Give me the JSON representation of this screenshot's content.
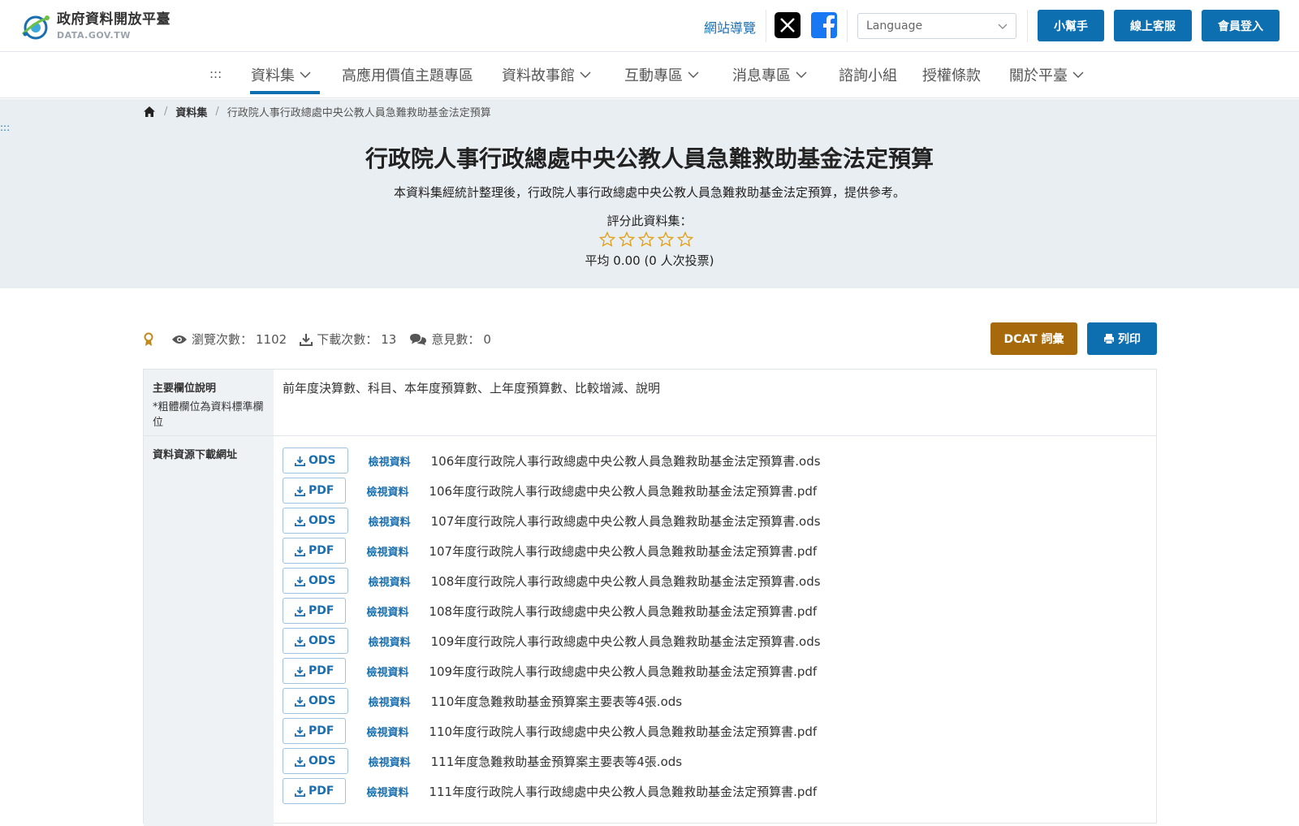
{
  "header": {
    "logo_cn": "政府資料開放平臺",
    "logo_en": "DATA.GOV.TW",
    "sitemap": "網站導覽",
    "language_placeholder": "Language",
    "buttons": [
      "小幫手",
      "線上客服",
      "會員登入"
    ]
  },
  "nav": {
    "dots": ":::",
    "items": [
      "資料集",
      "高應用價值主題專區",
      "資料故事館",
      "互動專區",
      "消息專區",
      "諮詢小組",
      "授權條款",
      "關於平臺"
    ]
  },
  "breadcrumb": {
    "items": [
      "資料集",
      "行政院人事行政總處中央公教人員急難救助基金法定預算"
    ]
  },
  "side_dots": ":::",
  "dataset": {
    "title": "行政院人事行政總處中央公教人員急難救助基金法定預算",
    "description": "本資料集經統計整理後，行政院人事行政總處中央公教人員急難救助基金法定預算，提供參考。",
    "rating_label": "評分此資料集：",
    "rating_value": 0,
    "rating_max": 5,
    "average": "平均 0.00 (0 人次投票)"
  },
  "stats": {
    "views_label": "瀏覽次數：",
    "views": "1102",
    "downloads_label": "下載次數：",
    "downloads": "13",
    "comments_label": "意見數：",
    "comments": "0"
  },
  "actions": {
    "dcat": "DCAT 詞彙",
    "print": "列印"
  },
  "fields": {
    "label": "主要欄位說明",
    "note": "*粗體欄位為資料標準欄位",
    "value": "前年度決算數、科目、本年度預算數、上年度預算數、比較增減、說明"
  },
  "resources": {
    "label": "資料資源下載網址",
    "view_label": "檢視資料",
    "items": [
      {
        "format": "ODS",
        "name": "106年度行政院人事行政總處中央公教人員急難救助基金法定預算書.ods"
      },
      {
        "format": "PDF",
        "name": "106年度行政院人事行政總處中央公教人員急難救助基金法定預算書.pdf"
      },
      {
        "format": "ODS",
        "name": "107年度行政院人事行政總處中央公教人員急難救助基金法定預算書.ods"
      },
      {
        "format": "PDF",
        "name": "107年度行政院人事行政總處中央公教人員急難救助基金法定預算書.pdf"
      },
      {
        "format": "ODS",
        "name": "108年度行政院人事行政總處中央公教人員急難救助基金法定預算書.ods"
      },
      {
        "format": "PDF",
        "name": "108年度行政院人事行政總處中央公教人員急難救助基金法定預算書.pdf"
      },
      {
        "format": "ODS",
        "name": "109年度行政院人事行政總處中央公教人員急難救助基金法定預算書.ods"
      },
      {
        "format": "PDF",
        "name": "109年度行政院人事行政總處中央公教人員急難救助基金法定預算書.pdf"
      },
      {
        "format": "ODS",
        "name": "110年度急難救助基金預算案主要表等4張.ods"
      },
      {
        "format": "PDF",
        "name": "110年度行政院人事行政總處中央公教人員急難救助基金法定預算書.pdf"
      },
      {
        "format": "ODS",
        "name": "111年度急難救助基金預算案主要表等4張.ods"
      },
      {
        "format": "PDF",
        "name": "111年度行政院人事行政總處中央公教人員急難救助基金法定預算書.pdf"
      }
    ]
  },
  "colors": {
    "primary": "#0d6fb0",
    "dcat": "#a66a0c",
    "hero_bg": "#e9eef2",
    "star": "#e0a21b"
  }
}
